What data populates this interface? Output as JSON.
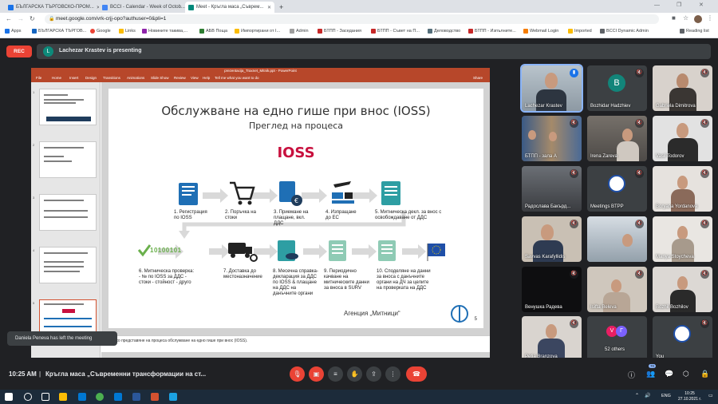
{
  "browser": {
    "tabs": [
      {
        "label": "БЪЛГАРСКА ТЪРГОВСКО-ПРОМ...",
        "color": "#1a73e8"
      },
      {
        "label": "BCCI - Calendar - Week of Octob...",
        "color": "#4285f4"
      },
      {
        "label": "Meet - Кръгла маса „Съврем...",
        "color": "#00897b",
        "active": true
      }
    ],
    "new_tab": "+",
    "url": "meet.google.com/vrk-crjj-opo?authuser=0&pli=1",
    "bookmarks": [
      "Apps",
      "БЪЛГАРСКА ТЪРГОВ...",
      "Google",
      "Links",
      "Новините такива,...",
      "АБВ Поща",
      "Импортирани от I...",
      "Admin",
      "БТПП - Заседания",
      "БТПП - Съвет на П...",
      "Деловодство",
      "БТПП - Изпълните...",
      "Webmail Login",
      "Imported",
      "BCCI Dynamic Admin"
    ],
    "reading_list": "Reading list"
  },
  "meet": {
    "rec_label": "REC",
    "presenter_initial": "L",
    "presenting_text": "Lachezar Krastev is presenting",
    "toast": "Daniela Peneva has left the meeting",
    "time": "10:25 AM",
    "separator": "|",
    "meeting_name": "Кръгла маса „Съвременни трансформации на ст...",
    "participants_badge": "70"
  },
  "presentation": {
    "window_title": "prezentacija_Traxnet_Mitnik.ppt - PowerPoint",
    "ribbon_tabs": [
      "File",
      "Home",
      "Insert",
      "Design",
      "Transitions",
      "Animations",
      "Slide Show",
      "Review",
      "View",
      "Help"
    ],
    "tell_me": "Tell me what you want to do",
    "share": "Share",
    "thumbs": [
      {
        "num": "1"
      },
      {
        "num": "2"
      },
      {
        "num": "3"
      },
      {
        "num": "4"
      },
      {
        "num": "5"
      }
    ],
    "slide": {
      "title": "Обслужване на едно гише при внос (IOSS)",
      "subtitle": "Преглед на процеса",
      "logo": "IOSS",
      "steps_top": [
        "1. Регистрация по IOSS",
        "2. Поръчка на стоки",
        "3. Приемане на плащане, вкл. ДДС",
        "4. Изпращане до ЕС",
        "5. Митническа декл. за внос с освобождаване от ДДС"
      ],
      "steps_bottom": [
        "6. Митническа проверка: - № по IOSS за ДДС - стоки - стойност - друго",
        "7. Доставка до местоназначение",
        "8. Месечна справка-декларация за ДДС по IOSS & плащане на ДДС на данъчните органи",
        "9. Периодично качване на митническите данни за вноса в SURV",
        "10. Споделяне на данни за вноса с данъчните органи на ДЧ за целите на проверката на ДДС"
      ],
      "code": "10100101",
      "agency": "Агенция „Митници“",
      "page": "5"
    },
    "notes": "Кратко представяне на процеса обслужване на едно гише при внос (IOSS).",
    "status": "Slide 5 of 13     English (United States)"
  },
  "participants": [
    {
      "name": "Lachezar Krastev",
      "type": "photo",
      "active": true
    },
    {
      "name": "Bozhidar Hadzhiev",
      "type": "avatar",
      "initial": "B",
      "color": "#12857a"
    },
    {
      "name": "Gabriela Dimitrova",
      "type": "photo"
    },
    {
      "name": "БТПП - зала А",
      "type": "photo"
    },
    {
      "name": "Irena Zareva",
      "type": "photo"
    },
    {
      "name": "Vasil Todorov",
      "type": "photo"
    },
    {
      "name": "Радослава Бакърд...",
      "type": "photo"
    },
    {
      "name": "Meetings BTPP",
      "type": "logo"
    },
    {
      "name": "Boryana Yordanova",
      "type": "photo"
    },
    {
      "name": "Savvas Karafyllidis",
      "type": "photo"
    },
    {
      "name": "",
      "type": "photo"
    },
    {
      "name": "Mariya Stoycheva",
      "type": "photo"
    },
    {
      "name": "Венушка Радева",
      "type": "dark"
    },
    {
      "name": "Isifta Beleva",
      "type": "photo"
    },
    {
      "name": "Bozhil Bozhilov",
      "type": "photo"
    },
    {
      "name": "Petia Branzova",
      "type": "photo"
    },
    {
      "name": "52 others",
      "type": "others"
    },
    {
      "name": "You",
      "type": "logo"
    }
  ],
  "taskbar": {
    "lang": "ENG",
    "clock_time": "10:25",
    "clock_date": "27.10.2021 г."
  },
  "colors": {
    "ppt_red": "#b7472a",
    "meet_red": "#ea4335",
    "slide_blue": "#1f6fb5",
    "ioss_red": "#c8103e"
  }
}
